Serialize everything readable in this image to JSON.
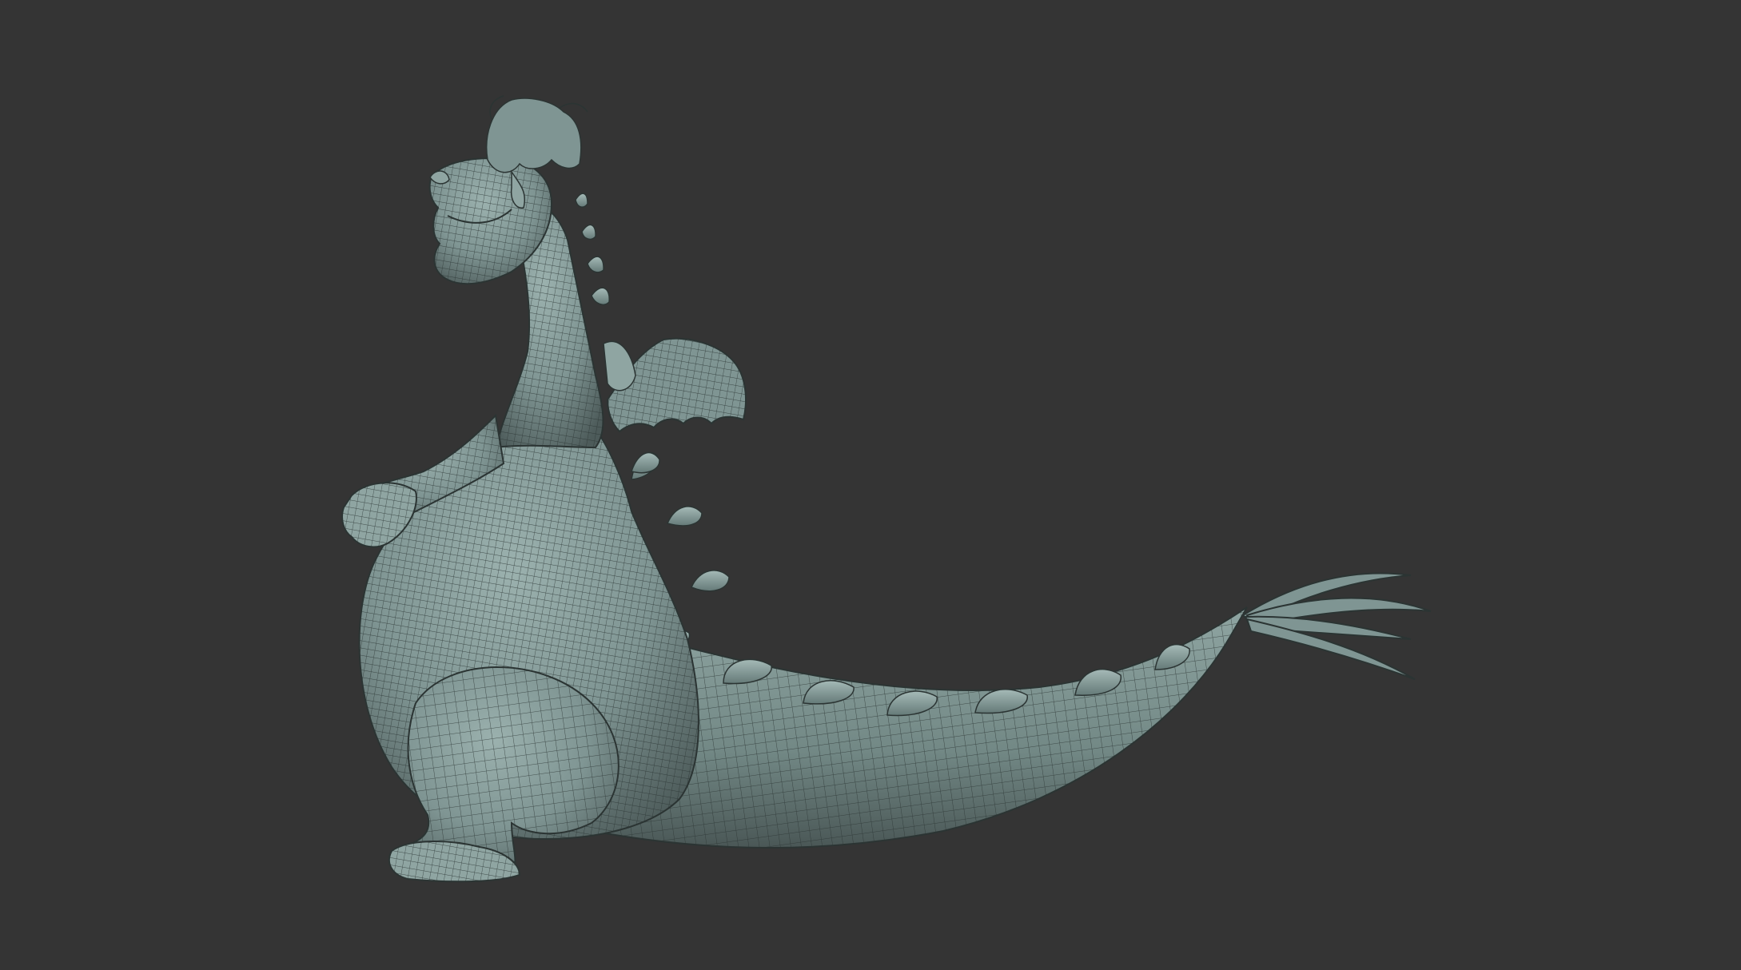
{
  "viewport": {
    "background_color": "#343434",
    "subject": "dragon-3d-mesh",
    "mesh_color": "#7f9593",
    "mesh_shadow_color": "#4d5b5a",
    "wireframe_color": "#2b3433",
    "render_mode": "wireframe-on-shaded"
  }
}
